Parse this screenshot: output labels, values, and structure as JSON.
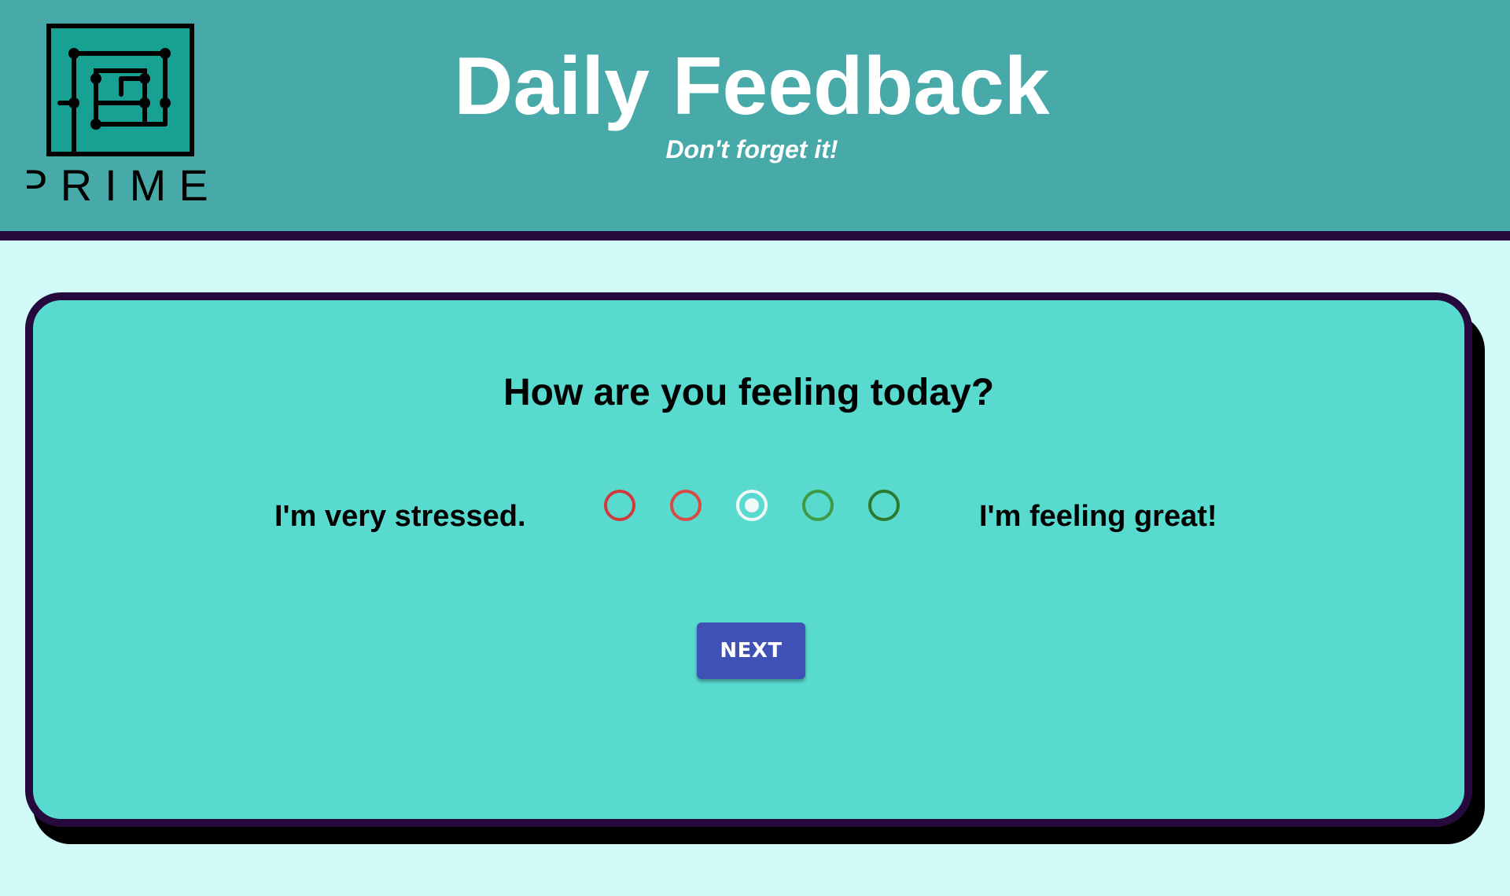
{
  "header": {
    "logo_text": "PRIME",
    "title": "Daily Feedback",
    "subtitle": "Don't forget it!"
  },
  "card": {
    "question": "How are you feeling today?",
    "label_left": "I'm very stressed.",
    "label_right": "I'm feeling great!",
    "options": [
      {
        "color": "#d13a3a",
        "selected": false
      },
      {
        "color": "#d94a44",
        "selected": false
      },
      {
        "color": "#f0f8f8",
        "selected": true
      },
      {
        "color": "#3e9a43",
        "selected": false
      },
      {
        "color": "#2b7a2f",
        "selected": false
      }
    ],
    "next_label": "NEXT"
  },
  "colors": {
    "header_bg": "#48a9a9",
    "page_bg": "#d2faf8",
    "card_bg": "#59dacf",
    "border": "#270a3d",
    "button_bg": "#3f51b5"
  }
}
